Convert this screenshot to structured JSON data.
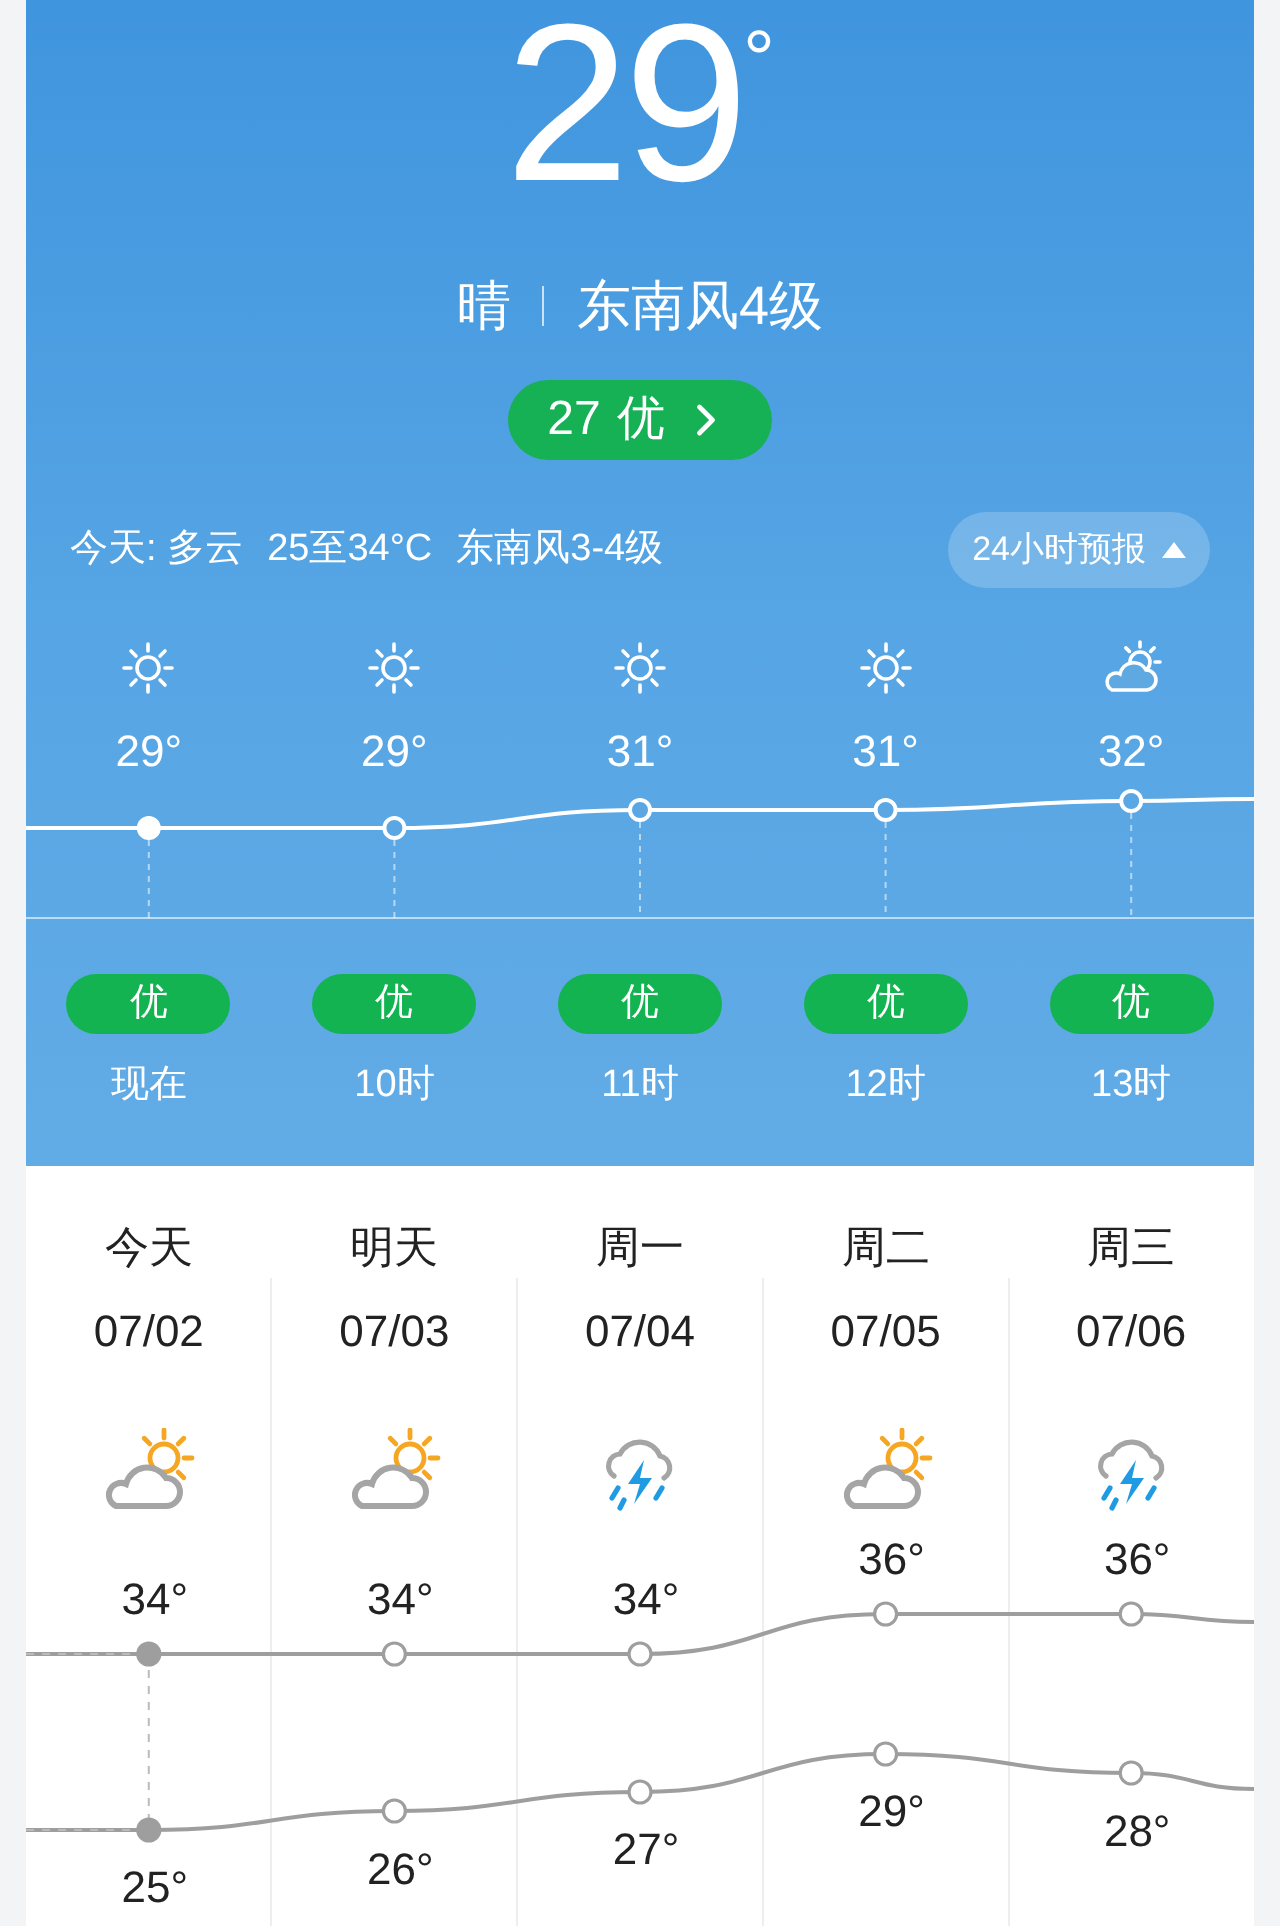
{
  "current": {
    "temperature": "29",
    "degree": "°",
    "weather": "晴",
    "wind": "东南风4级",
    "aqi": {
      "value": "27",
      "level": "优"
    }
  },
  "today_summary": [
    "今天: 多云",
    "25至34°C",
    "东南风3-4级"
  ],
  "forecast_button": {
    "label": "24小时预报",
    "expanded": true
  },
  "hourly": [
    {
      "kind": "sunny",
      "temp": "29°",
      "aqi": "优",
      "time": "现在",
      "current": true
    },
    {
      "kind": "sunny",
      "temp": "29°",
      "aqi": "优",
      "time": "10时",
      "current": false
    },
    {
      "kind": "sunny",
      "temp": "31°",
      "aqi": "优",
      "time": "11时",
      "current": false
    },
    {
      "kind": "sunny",
      "temp": "31°",
      "aqi": "优",
      "time": "12时",
      "current": false
    },
    {
      "kind": "cloudy",
      "temp": "32°",
      "aqi": "优",
      "time": "13时",
      "current": false
    }
  ],
  "daily": [
    {
      "day": "今天",
      "date": "07/02",
      "kind": "cloudy",
      "high": "34°",
      "low": "25°",
      "current": true
    },
    {
      "day": "明天",
      "date": "07/03",
      "kind": "cloudy",
      "high": "34°",
      "low": "26°",
      "current": false
    },
    {
      "day": "周一",
      "date": "07/04",
      "kind": "thunder",
      "high": "34°",
      "low": "27°",
      "current": false
    },
    {
      "day": "周二",
      "date": "07/05",
      "kind": "cloudy",
      "high": "36°",
      "low": "29°",
      "current": false
    },
    {
      "day": "周三",
      "date": "07/06",
      "kind": "thunder",
      "high": "36°",
      "low": "28°",
      "current": false
    }
  ]
}
